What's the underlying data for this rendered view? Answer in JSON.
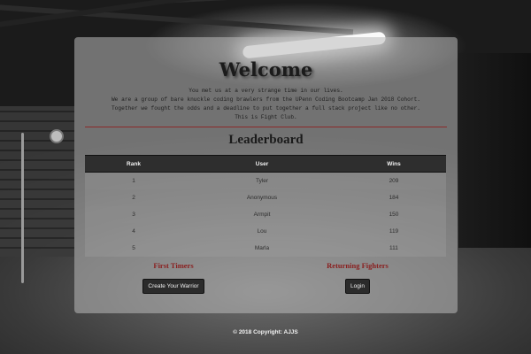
{
  "hero": {
    "title": "Welcome",
    "intro_lines": [
      "You met us at a very strange time in our lives.",
      "We are a group of bare knuckle coding brawlers from the UPenn Coding Bootcamp Jan 2018 Cohort.",
      "Together we fought the odds and a deadline to put together a full stack project like no other.",
      "This is Fight Club."
    ]
  },
  "leaderboard": {
    "title": "Leaderboard",
    "columns": [
      "Rank",
      "User",
      "Wins"
    ],
    "rows": [
      {
        "rank": "1",
        "user": "Tyler",
        "wins": "209"
      },
      {
        "rank": "2",
        "user": "Anonymous",
        "wins": "184"
      },
      {
        "rank": "3",
        "user": "Armpit",
        "wins": "150"
      },
      {
        "rank": "4",
        "user": "Lou",
        "wins": "119"
      },
      {
        "rank": "5",
        "user": "Marla",
        "wins": "111"
      }
    ]
  },
  "first_timers": {
    "heading": "First Timers",
    "button_label": "Create Your Warrior"
  },
  "returning": {
    "heading": "Returning Fighters",
    "button_label": "Login"
  },
  "footer": {
    "text": "© 2018 Copyright: AJJS"
  },
  "colors": {
    "accent_red": "#8a2020",
    "table_header": "#2e2e2e",
    "button_bg": "#2b2b2b"
  }
}
